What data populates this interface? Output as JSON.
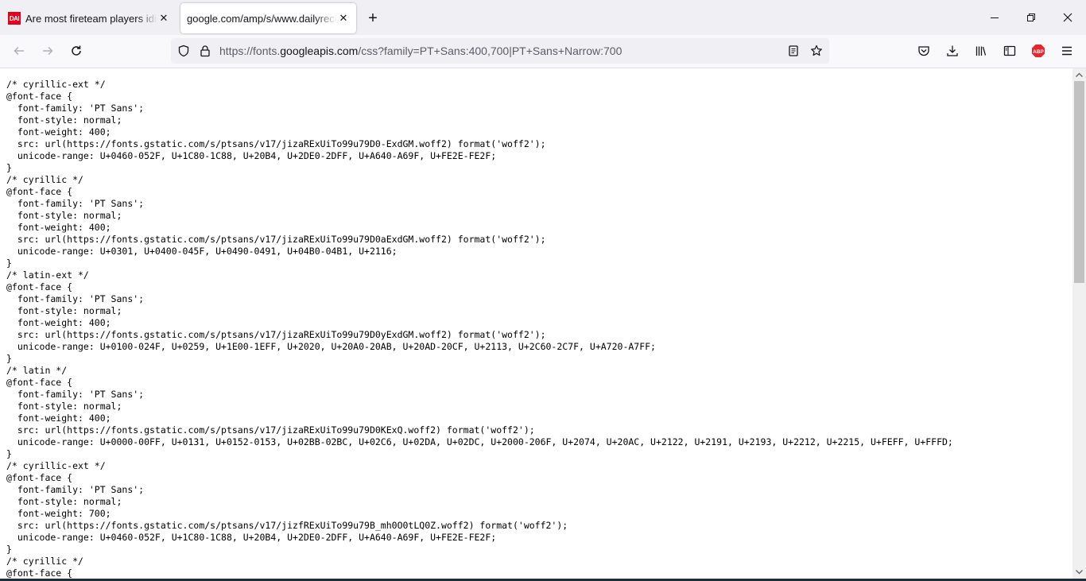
{
  "browser": {
    "tabs": [
      {
        "title": "Are most fireteam players idiots",
        "favicon_text": "DAI",
        "active": false
      },
      {
        "title": "google.com/amp/s/www.dailyrecord.co.uk",
        "active": true
      }
    ],
    "url": {
      "prefix": "https://fonts.",
      "host": "googleapis.com",
      "path": "/css?family=PT+Sans:400,700|PT+Sans+Narrow:700"
    },
    "icons": {
      "back": "back-arrow-icon",
      "forward": "forward-arrow-icon",
      "reload": "reload-icon",
      "shield": "tracking-protection-shield-icon",
      "lock": "lock-icon",
      "reader": "reader-view-icon",
      "bookmark": "bookmark-star-icon",
      "pocket": "pocket-icon",
      "downloads": "download-icon",
      "library": "library-icon",
      "sidebar": "sidebar-icon",
      "adblock": "adblock-plus-icon",
      "menu": "hamburger-menu-icon"
    },
    "adblock_label": "ABP",
    "colors": {
      "adblock": "#e8252c",
      "favicon": "#e2001a"
    }
  },
  "page": {
    "css_text": "/* cyrillic-ext */\n@font-face {\n  font-family: 'PT Sans';\n  font-style: normal;\n  font-weight: 400;\n  src: url(https://fonts.gstatic.com/s/ptsans/v17/jizaRExUiTo99u79D0-ExdGM.woff2) format('woff2');\n  unicode-range: U+0460-052F, U+1C80-1C88, U+20B4, U+2DE0-2DFF, U+A640-A69F, U+FE2E-FE2F;\n}\n/* cyrillic */\n@font-face {\n  font-family: 'PT Sans';\n  font-style: normal;\n  font-weight: 400;\n  src: url(https://fonts.gstatic.com/s/ptsans/v17/jizaRExUiTo99u79D0aExdGM.woff2) format('woff2');\n  unicode-range: U+0301, U+0400-045F, U+0490-0491, U+04B0-04B1, U+2116;\n}\n/* latin-ext */\n@font-face {\n  font-family: 'PT Sans';\n  font-style: normal;\n  font-weight: 400;\n  src: url(https://fonts.gstatic.com/s/ptsans/v17/jizaRExUiTo99u79D0yExdGM.woff2) format('woff2');\n  unicode-range: U+0100-024F, U+0259, U+1E00-1EFF, U+2020, U+20A0-20AB, U+20AD-20CF, U+2113, U+2C60-2C7F, U+A720-A7FF;\n}\n/* latin */\n@font-face {\n  font-family: 'PT Sans';\n  font-style: normal;\n  font-weight: 400;\n  src: url(https://fonts.gstatic.com/s/ptsans/v17/jizaRExUiTo99u79D0KExQ.woff2) format('woff2');\n  unicode-range: U+0000-00FF, U+0131, U+0152-0153, U+02BB-02BC, U+02C6, U+02DA, U+02DC, U+2000-206F, U+2074, U+20AC, U+2122, U+2191, U+2193, U+2212, U+2215, U+FEFF, U+FFFD;\n}\n/* cyrillic-ext */\n@font-face {\n  font-family: 'PT Sans';\n  font-style: normal;\n  font-weight: 700;\n  src: url(https://fonts.gstatic.com/s/ptsans/v17/jizfRExUiTo99u79B_mh0O0tLQ0Z.woff2) format('woff2');\n  unicode-range: U+0460-052F, U+1C80-1C88, U+20B4, U+2DE0-2DFF, U+A640-A69F, U+FE2E-FE2F;\n}\n/* cyrillic */\n@font-face {"
  }
}
